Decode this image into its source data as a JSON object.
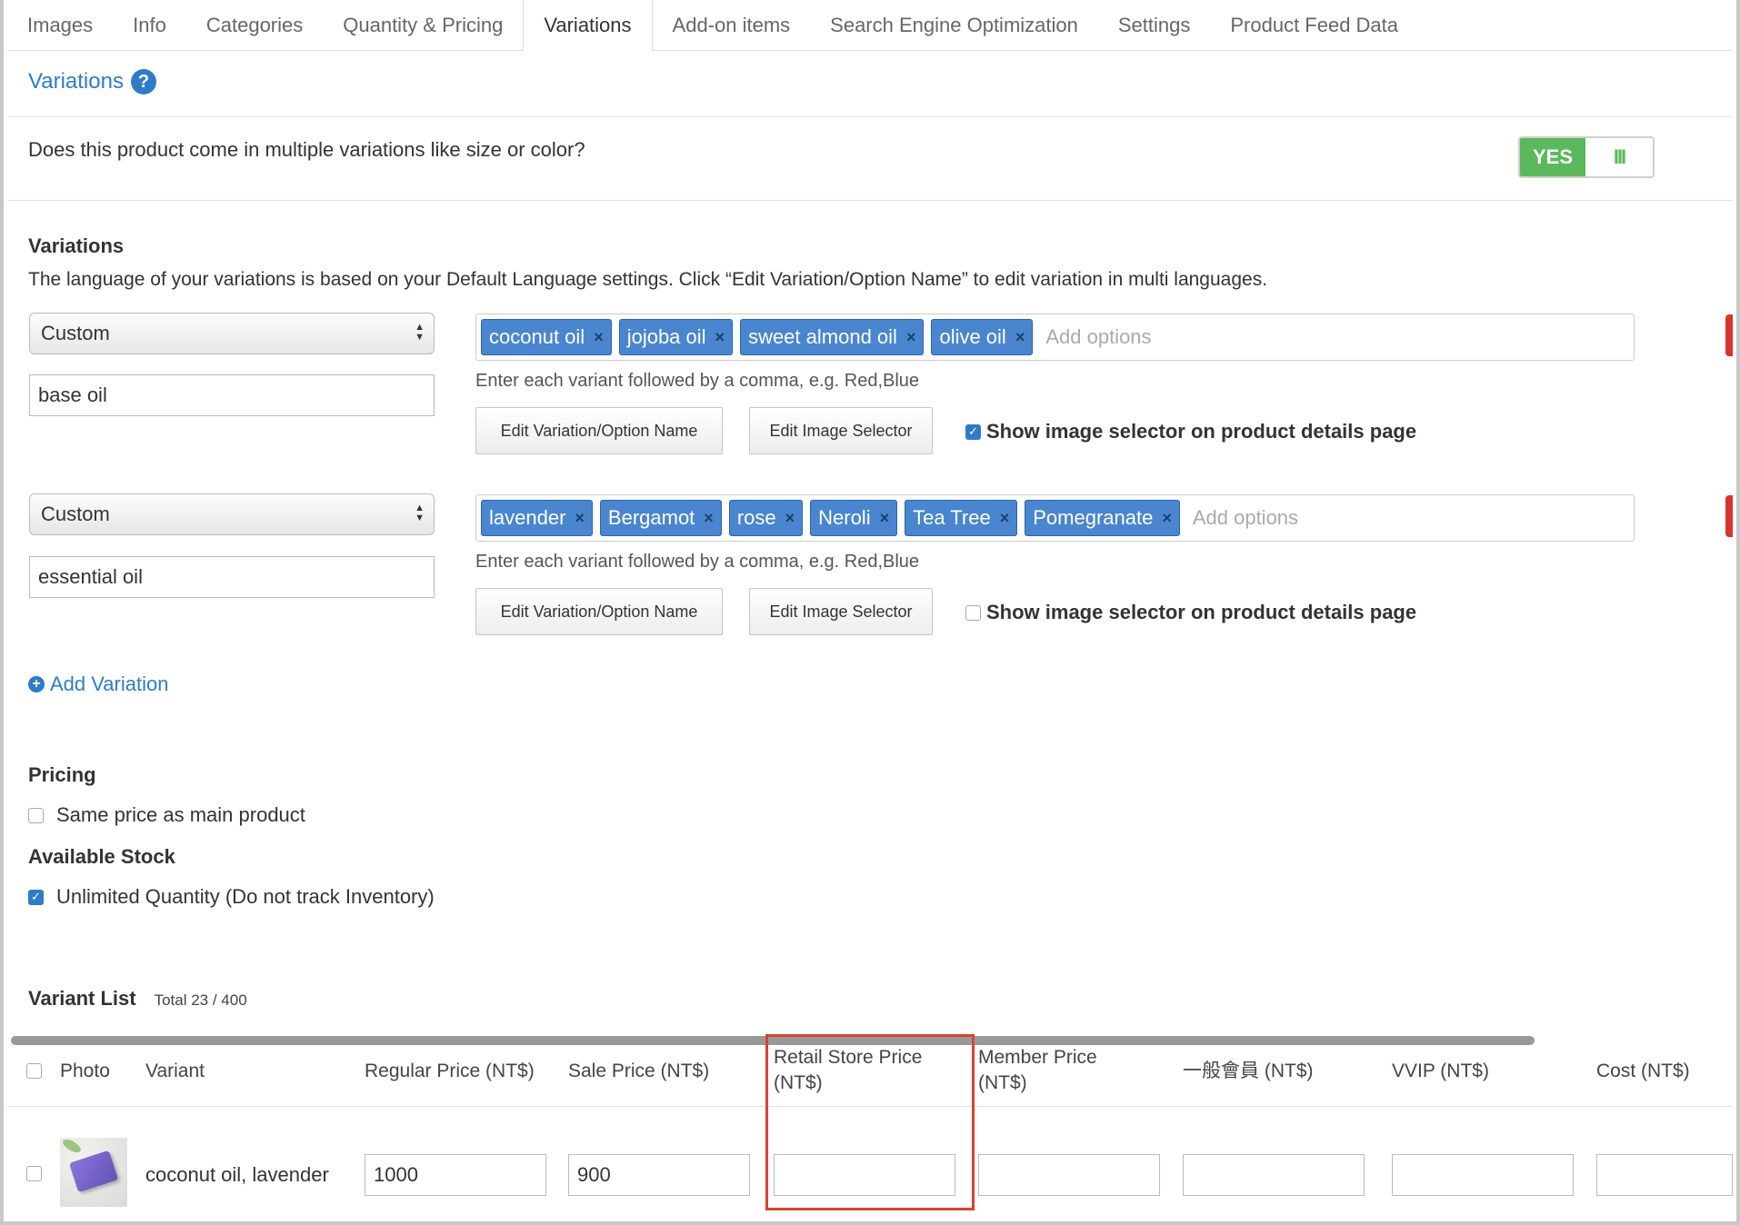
{
  "tabs": [
    {
      "label": "Images",
      "active": false
    },
    {
      "label": "Info",
      "active": false
    },
    {
      "label": "Categories",
      "active": false
    },
    {
      "label": "Quantity & Pricing",
      "active": false
    },
    {
      "label": "Variations",
      "active": true
    },
    {
      "label": "Add-on items",
      "active": false
    },
    {
      "label": "Search Engine Optimization",
      "active": false
    },
    {
      "label": "Settings",
      "active": false
    },
    {
      "label": "Product Feed Data",
      "active": false
    }
  ],
  "section": {
    "title": "Variations",
    "help_icon": "?"
  },
  "multi_question": {
    "text": "Does this product come in multiple variations like size or color?",
    "toggle_label": "YES",
    "toggle_handle": "III",
    "toggle_on": true
  },
  "variations": {
    "heading": "Variations",
    "description": "The language of your variations is based on your Default Language settings. Click “Edit Variation/Option Name” to edit variation in multi languages.",
    "groups": [
      {
        "type_select": "Custom",
        "name": "base oil",
        "options": [
          "coconut oil",
          "jojoba oil",
          "sweet almond oil",
          "olive oil"
        ],
        "add_placeholder": "Add options",
        "hint": "Enter each variant followed by a comma, e.g. Red,Blue",
        "edit_name_btn": "Edit Variation/Option Name",
        "edit_image_btn": "Edit Image Selector",
        "show_image_label": "Show image selector on product details page",
        "show_image_checked": true
      },
      {
        "type_select": "Custom",
        "name": "essential oil",
        "options": [
          "lavender",
          "Bergamot",
          "rose",
          "Neroli",
          "Tea Tree",
          "Pomegranate"
        ],
        "add_placeholder": "Add options",
        "hint": "Enter each variant followed by a comma, e.g. Red,Blue",
        "edit_name_btn": "Edit Variation/Option Name",
        "edit_image_btn": "Edit Image Selector",
        "show_image_label": "Show image selector on product details page",
        "show_image_checked": false
      }
    ],
    "add_variation": "Add Variation"
  },
  "pricing": {
    "heading": "Pricing",
    "same_price_label": "Same price as main product",
    "same_price_checked": false
  },
  "stock": {
    "heading": "Available Stock",
    "unlimited_label": "Unlimited Quantity (Do not track Inventory)",
    "unlimited_checked": true
  },
  "variant_list": {
    "title": "Variant List",
    "total": "Total 23 / 400",
    "columns": {
      "photo": "Photo",
      "variant": "Variant",
      "regular_price": "Regular Price (NT$)",
      "sale_price": "Sale Price (NT$)",
      "retail_price_1": "Retail Store Price",
      "retail_price_2": "(NT$)",
      "member_price_1": "Member Price",
      "member_price_2": "(NT$)",
      "general_member": "一般會員 (NT$)",
      "vvip": "VVIP (NT$)",
      "cost": "Cost (NT$)"
    },
    "rows": [
      {
        "variant": "coconut oil, lavender",
        "regular_price": "1000",
        "sale_price": "900",
        "retail_price": "",
        "member_price": "",
        "general_member": "",
        "vvip": "",
        "cost": ""
      }
    ]
  },
  "colors": {
    "link_blue": "#2f7bc8",
    "tag_blue": "#4a86cf",
    "toggle_green": "#5cb85c",
    "highlight_red": "#d9432e"
  }
}
